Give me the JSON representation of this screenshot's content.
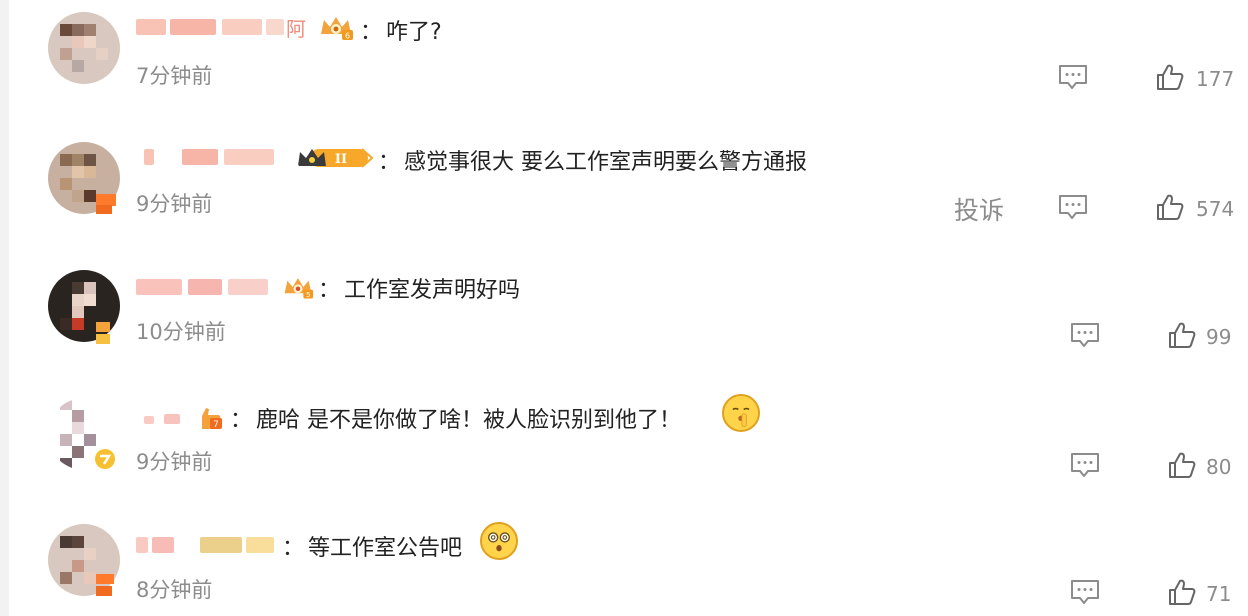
{
  "separator": "：",
  "comments": [
    {
      "text": "咋了?",
      "time": "7分钟前",
      "likes": "177",
      "report": "",
      "nick_suffix": "阿",
      "crown_level": "6"
    },
    {
      "text": "感觉事很大 要么工作室声明要么警方通报",
      "time": "9分钟前",
      "likes": "574",
      "report": "投诉",
      "nick_suffix": "",
      "crown_level": "II"
    },
    {
      "text": "工作室发声明好吗",
      "time": "10分钟前",
      "likes": "99",
      "report": "",
      "nick_suffix": "",
      "crown_level": "5"
    },
    {
      "text": "鹿哈 是不是你做了啥！被人脸识别到他了！",
      "time": "9分钟前",
      "likes": "80",
      "report": "",
      "nick_suffix": "",
      "crown_level": ""
    },
    {
      "text": "等工作室公告吧",
      "time": "8分钟前",
      "likes": "71",
      "report": "",
      "nick_suffix": "",
      "crown_level": ""
    }
  ],
  "icons": {
    "reply": "comment-icon",
    "like": "thumbs-up-icon",
    "emoji_4": "shush-face-emoji",
    "emoji_5": "dizzy-face-emoji"
  },
  "colors": {
    "time": "#8c8c8c",
    "text": "#222222",
    "crown": "#f4a23c",
    "verified": "#ff7a2a"
  }
}
